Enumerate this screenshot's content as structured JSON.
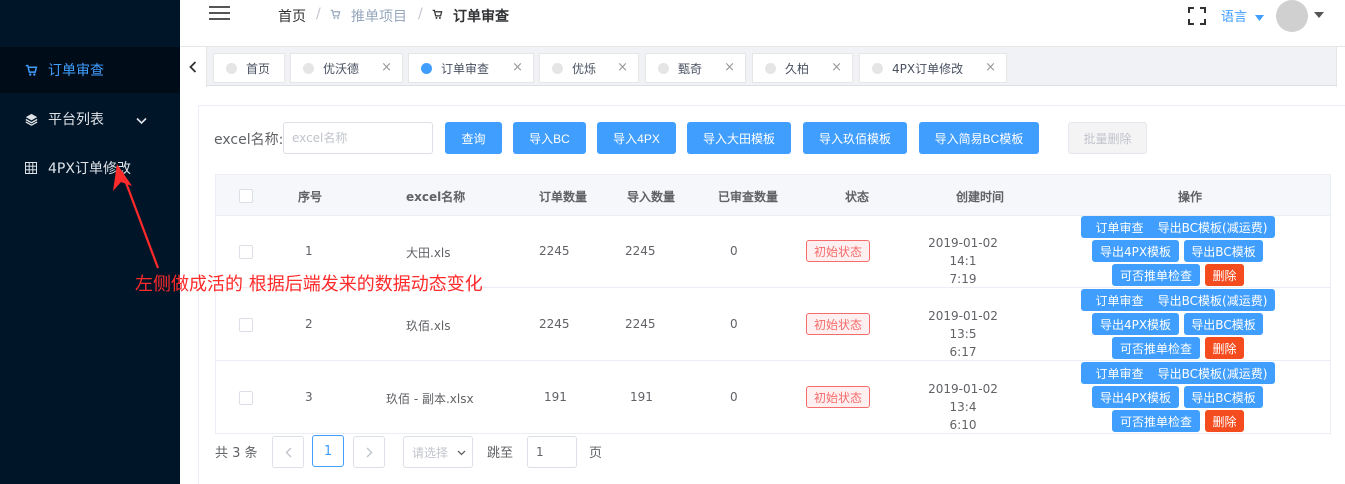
{
  "sidebar": {
    "items": [
      {
        "label": "订单审查",
        "icon": "cart-icon",
        "active": true
      },
      {
        "label": "平台列表",
        "icon": "layers-icon",
        "expandable": true
      },
      {
        "label": "4PX订单修改",
        "icon": "grid-icon"
      }
    ]
  },
  "header": {
    "breadcrumb": [
      "首页",
      "推单项目",
      "订单审查"
    ],
    "language_label": "语言"
  },
  "tabs": [
    {
      "label": "首页",
      "active": false
    },
    {
      "label": "优沃德",
      "active": false
    },
    {
      "label": "订单审查",
      "active": true
    },
    {
      "label": "优烁",
      "active": false
    },
    {
      "label": "甄奇",
      "active": false
    },
    {
      "label": "久柏",
      "active": false
    },
    {
      "label": "4PX订单修改",
      "active": false
    }
  ],
  "filter": {
    "label": "excel名称:",
    "placeholder": "excel名称",
    "buttons": {
      "query": "查询",
      "import_bc": "导入BC",
      "import_4px": "导入4PX",
      "import_datian": "导入大田模板",
      "import_jiubai": "导入玖佰模板",
      "import_simple_bc": "导入简易BC模板",
      "batch_delete": "批量删除"
    }
  },
  "table": {
    "columns": [
      "序号",
      "excel名称",
      "订单数量",
      "导入数量",
      "已审查数量",
      "状态",
      "创建时间",
      "操作"
    ],
    "rows": [
      {
        "index": "1",
        "name": "大田.xls",
        "orders": "2245",
        "imported": "2245",
        "reviewed": "0",
        "status": "初始状态",
        "time_line1": "2019-01-02 14:1",
        "time_line2": "7:19"
      },
      {
        "index": "2",
        "name": "玖佰.xls",
        "orders": "2245",
        "imported": "2245",
        "reviewed": "0",
        "status": "初始状态",
        "time_line1": "2019-01-02 13:5",
        "time_line2": "6:17"
      },
      {
        "index": "3",
        "name": "玖佰 - 副本.xlsx",
        "orders": "191",
        "imported": "191",
        "reviewed": "0",
        "status": "初始状态",
        "time_line1": "2019-01-02 13:4",
        "time_line2": "6:10"
      }
    ],
    "actions": {
      "review": "订单审查",
      "export_bc_less": "导出BC模板(减运费)",
      "export_4px": "导出4PX模板",
      "export_bc": "导出BC模板",
      "push_check": "可否推单检查",
      "delete": "删除"
    }
  },
  "pagination": {
    "total_text": "共 3 条",
    "current_page": "1",
    "size_placeholder": "请选择",
    "jump_label": "跳至",
    "jump_value": "1",
    "page_suffix": "页"
  },
  "annotation": {
    "text": "左侧做成活的 根据后端发来的数据动态变化",
    "color": "#ff2a2a"
  },
  "colors": {
    "primary": "#409eff",
    "danger": "#f44c1e",
    "sidebar_bg": "#001528"
  }
}
